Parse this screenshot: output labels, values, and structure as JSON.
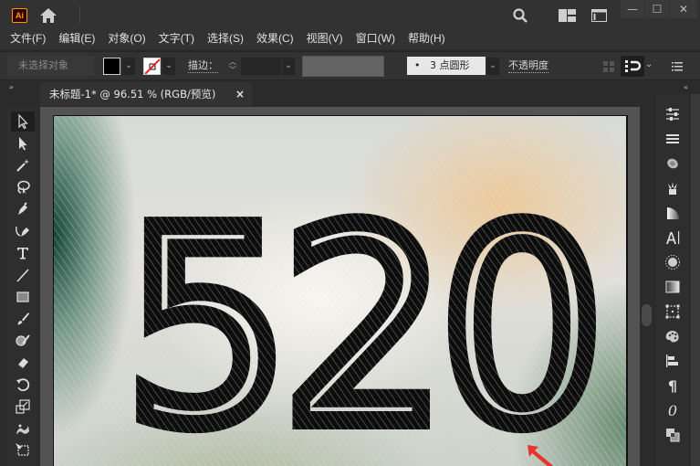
{
  "app": {
    "logo_text": "Ai",
    "window_controls": {
      "minimize": "—",
      "maximize": "☐",
      "close": "✕"
    }
  },
  "menu": {
    "items": [
      {
        "label": "文件(F)"
      },
      {
        "label": "编辑(E)"
      },
      {
        "label": "对象(O)"
      },
      {
        "label": "文字(T)"
      },
      {
        "label": "选择(S)"
      },
      {
        "label": "效果(C)"
      },
      {
        "label": "视图(V)"
      },
      {
        "label": "窗口(W)"
      },
      {
        "label": "帮助(H)"
      }
    ]
  },
  "control_bar": {
    "selection_status": "未选择对象",
    "fill_color": "#000000",
    "stroke_label": "描边：",
    "stroke_weight": "",
    "brush_definition": "3 点圆形",
    "brush_bullet": "•",
    "opacity_label": "不透明度"
  },
  "document": {
    "tab_title": "未标题-1* @ 96.51 % (RGB/预览)",
    "close_glyph": "×",
    "artwork_text": "520",
    "accent_arrow_color": "#e8342c"
  },
  "toolbar": {
    "tools": [
      {
        "name": "selection-tool",
        "active": true
      },
      {
        "name": "direct-selection-tool"
      },
      {
        "name": "magic-wand-tool"
      },
      {
        "name": "lasso-tool"
      },
      {
        "name": "pen-tool"
      },
      {
        "name": "curvature-tool"
      },
      {
        "name": "type-tool",
        "glyph": "T"
      },
      {
        "name": "line-segment-tool"
      },
      {
        "name": "rectangle-tool"
      },
      {
        "name": "paintbrush-tool"
      },
      {
        "name": "shaper-tool"
      },
      {
        "name": "eraser-tool"
      },
      {
        "name": "rotate-tool"
      },
      {
        "name": "scale-tool"
      },
      {
        "name": "puppet-warp-tool"
      },
      {
        "name": "free-transform-tool"
      }
    ]
  },
  "right_panel": {
    "icons": [
      "properties-icon",
      "layers-icon",
      "libraries-icon",
      "symbols-icon",
      "gradient-icon",
      "character-icon",
      "brightness-icon",
      "transparency-icon",
      "transform-icon",
      "color-guide-icon",
      "align-icon",
      "paragraph-icon",
      "glyphs-icon",
      "pathfinder-icon"
    ],
    "character_glyph": "A|",
    "paragraph_glyph": "¶",
    "glyphs_glyph": "0"
  },
  "panel_toggles": {
    "expand_left": "»",
    "collapse_right": "«"
  }
}
